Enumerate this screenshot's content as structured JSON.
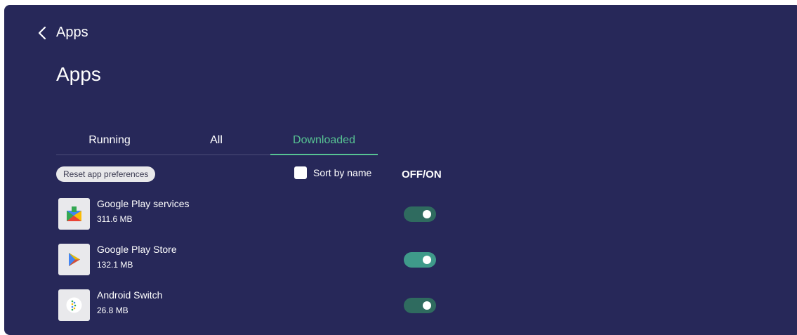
{
  "header": {
    "back_label": "Apps"
  },
  "page": {
    "title": "Apps"
  },
  "tabs": [
    {
      "label": "Running",
      "selected": false
    },
    {
      "label": "All",
      "selected": false
    },
    {
      "label": "Downloaded",
      "selected": true
    }
  ],
  "controls": {
    "reset_label": "Reset app preferences",
    "sort_label": "Sort by name",
    "sort_checked": false,
    "offon_label": "OFF/ON"
  },
  "apps": [
    {
      "name": "Google Play services",
      "size": "311.6 MB",
      "icon": "google-play-services-icon",
      "enabled": true,
      "toggle_color": "#2f6b5f"
    },
    {
      "name": "Google Play Store",
      "size": "132.1 MB",
      "icon": "google-play-store-icon",
      "enabled": true,
      "toggle_color": "#3f9a8a"
    },
    {
      "name": "Android Switch",
      "size": "26.8 MB",
      "icon": "android-switch-icon",
      "enabled": true,
      "toggle_color": "#2f6b5f"
    }
  ],
  "colors": {
    "background": "#272859",
    "accent": "#57c393"
  }
}
